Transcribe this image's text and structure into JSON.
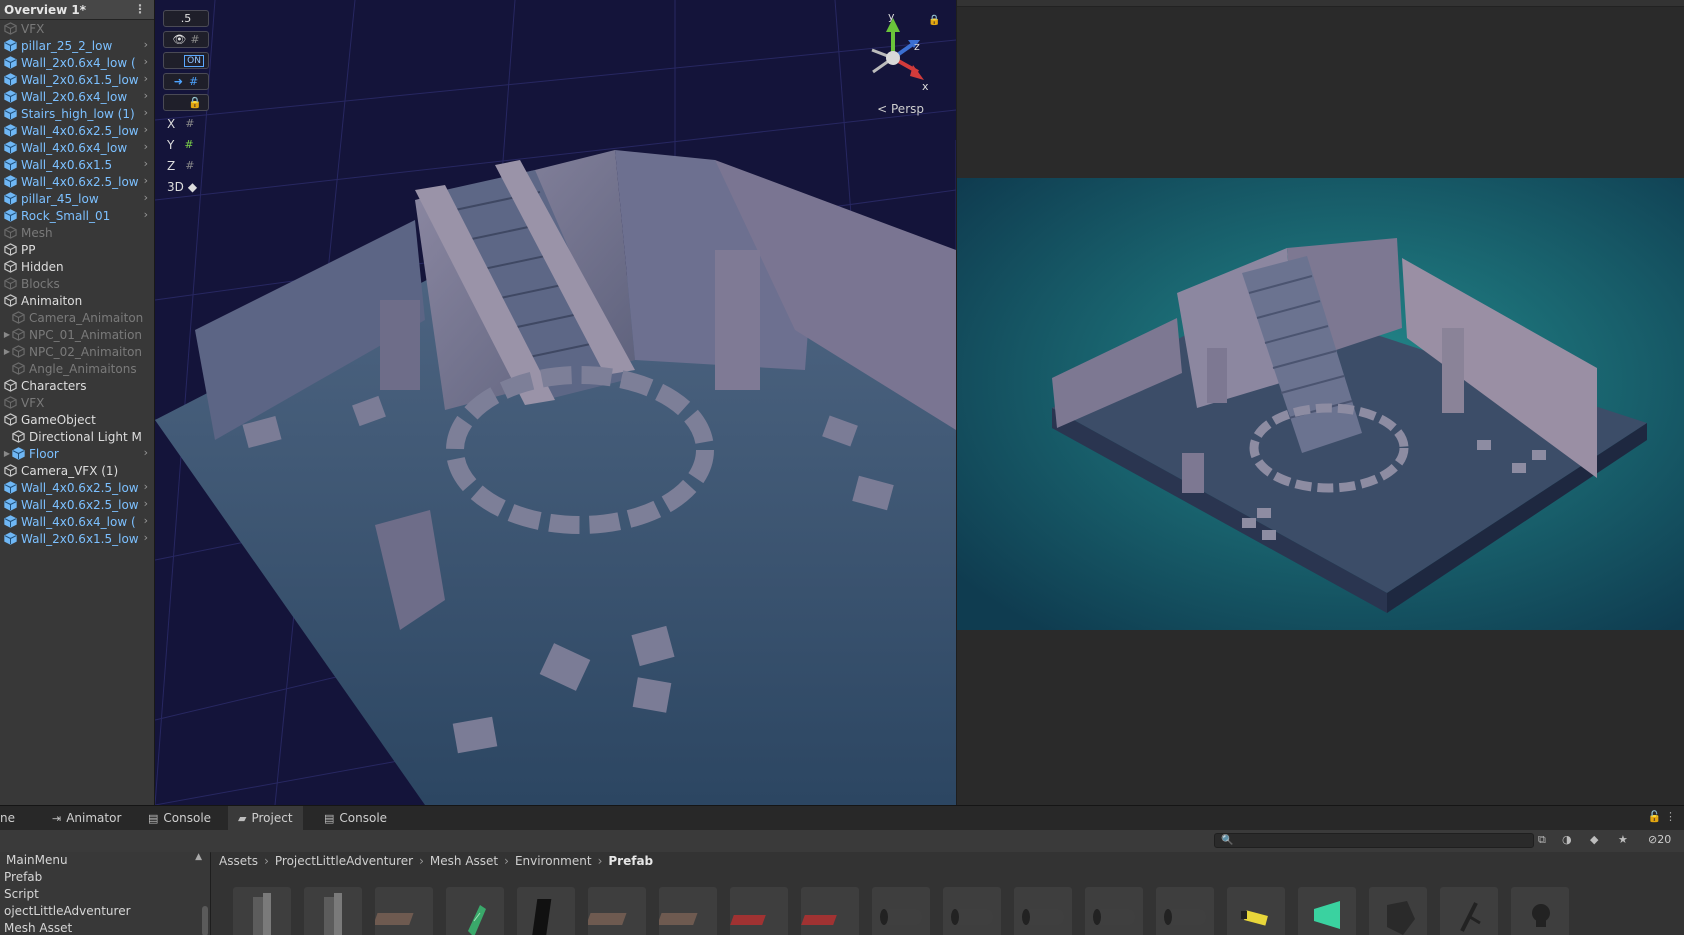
{
  "hierarchy": {
    "title": "Overview 1*",
    "items": [
      {
        "label": "VFX",
        "style": "dim"
      },
      {
        "label": "pillar_25_2_low",
        "style": "blue",
        "chevron": true
      },
      {
        "label": "Wall_2x0.6x4_low (",
        "style": "blue",
        "chevron": true
      },
      {
        "label": "Wall_2x0.6x1.5_low",
        "style": "blue",
        "chevron": true
      },
      {
        "label": "Wall_2x0.6x4_low",
        "style": "blue",
        "chevron": true
      },
      {
        "label": "Stairs_high_low (1)",
        "style": "blue",
        "chevron": true
      },
      {
        "label": "Wall_4x0.6x2.5_low",
        "style": "blue",
        "chevron": true
      },
      {
        "label": "Wall_4x0.6x4_low",
        "style": "blue",
        "chevron": true
      },
      {
        "label": "Wall_4x0.6x1.5",
        "style": "blue",
        "chevron": true
      },
      {
        "label": "Wall_4x0.6x2.5_low",
        "style": "blue",
        "chevron": true
      },
      {
        "label": "pillar_45_low",
        "style": "blue",
        "chevron": true
      },
      {
        "label": "Rock_Small_01",
        "style": "blue",
        "chevron": true
      },
      {
        "label": "Mesh",
        "style": "dim"
      },
      {
        "label": "PP",
        "style": "white"
      },
      {
        "label": "Hidden",
        "style": "white"
      },
      {
        "label": "Blocks",
        "style": "dim"
      },
      {
        "label": "Animaiton",
        "style": "white"
      },
      {
        "label": "Camera_Animaiton",
        "style": "dim",
        "indent": 1
      },
      {
        "label": "NPC_01_Animation",
        "style": "dim",
        "indent": 1,
        "fold": true
      },
      {
        "label": "NPC_02_Animaiton",
        "style": "dim",
        "indent": 1,
        "fold": true
      },
      {
        "label": "Angle_Animaitons",
        "style": "dim",
        "indent": 1
      },
      {
        "label": "Characters",
        "style": "white"
      },
      {
        "label": "VFX",
        "style": "dim"
      },
      {
        "label": "GameObject",
        "style": "white"
      },
      {
        "label": "Directional Light M",
        "style": "white",
        "indent": 1
      },
      {
        "label": "Floor",
        "style": "blue",
        "indent": 1,
        "fold": true,
        "chevron": true
      },
      {
        "label": "Camera_VFX (1)",
        "style": "white"
      },
      {
        "label": "Wall_4x0.6x2.5_low",
        "style": "blue",
        "chevron": true
      },
      {
        "label": "Wall_4x0.6x2.5_low",
        "style": "blue",
        "chevron": true
      },
      {
        "label": "Wall_4x0.6x4_low (",
        "style": "blue",
        "chevron": true
      },
      {
        "label": "Wall_2x0.6x1.5_low",
        "style": "blue",
        "chevron": true
      }
    ]
  },
  "scene": {
    "toolbar": {
      "scale_value": ".5",
      "toggle_label": "ON",
      "axes": [
        "X",
        "Y",
        "Z"
      ],
      "mode_label": "3D"
    },
    "gizmo": {
      "y": "y",
      "z": "z",
      "x": "x"
    },
    "projection_label": "Persp"
  },
  "tabs": [
    {
      "label": "ne",
      "icon": ""
    },
    {
      "label": "Animator",
      "icon": "animator-icon"
    },
    {
      "label": "Console",
      "icon": "console-icon"
    },
    {
      "label": "Project",
      "icon": "folder-icon",
      "active": true
    },
    {
      "label": "Console",
      "icon": "console-icon"
    }
  ],
  "project": {
    "hidden_count": "20",
    "tree": [
      "MainMenu",
      "Prefab",
      "Script",
      "ojectLittleAdventurer",
      "Mesh Asset"
    ],
    "breadcrumb": [
      "Assets",
      "ProjectLittleAdventurer",
      "Mesh Asset",
      "Environment",
      "Prefab"
    ],
    "thumbnails": [
      "wall-corner",
      "wall-corner",
      "floor-tiles-grid",
      "green-crystal",
      "dark-panel",
      "floor-tiles-grid",
      "floor-tiles-grid",
      "red-tiles",
      "red-tiles",
      "log",
      "log",
      "log",
      "log",
      "log",
      "yellow-prop",
      "green-cone",
      "dark-rock",
      "branch",
      "skull"
    ]
  },
  "colors": {
    "hierarchy_blue": "#7cc0ff",
    "scene_bg": "#14143a",
    "game_bg": "#1f7d80"
  }
}
